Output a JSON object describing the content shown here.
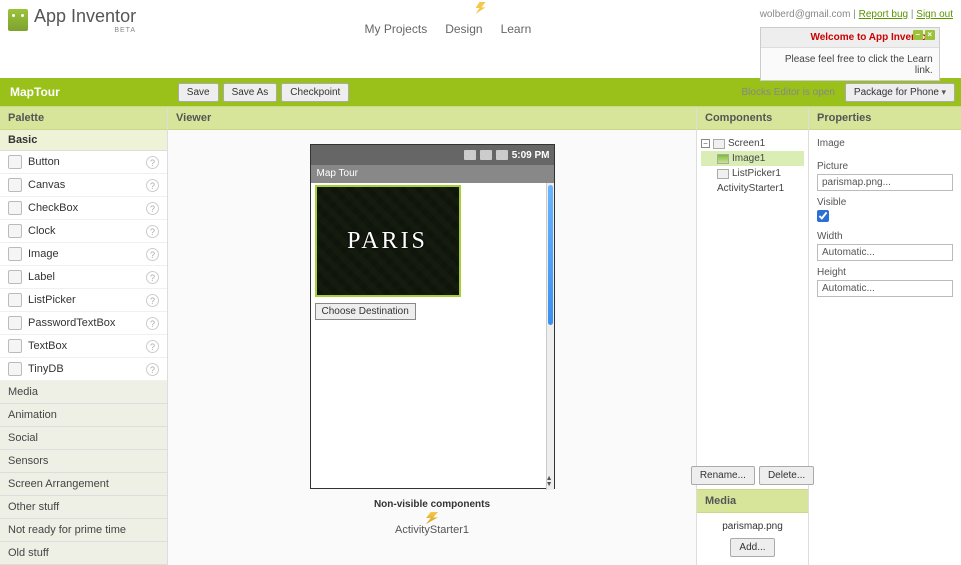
{
  "header": {
    "app_name": "App Inventor",
    "app_sub": "BETA",
    "nav": {
      "projects": "My Projects",
      "design": "Design",
      "learn": "Learn"
    },
    "user_email": "wolberd@gmail.com",
    "report_bug": "Report bug",
    "sign_out": "Sign out",
    "welcome_title": "Welcome to App Inventor.",
    "welcome_body": "Please feel free to click the Learn link."
  },
  "greenbar": {
    "title": "MapTour",
    "save": "Save",
    "save_as": "Save As",
    "checkpoint": "Checkpoint",
    "editor_status": "Blocks Editor is open",
    "package": "Package for Phone"
  },
  "palette": {
    "header": "Palette",
    "basic": "Basic",
    "items": [
      {
        "label": "Button"
      },
      {
        "label": "Canvas"
      },
      {
        "label": "CheckBox"
      },
      {
        "label": "Clock"
      },
      {
        "label": "Image"
      },
      {
        "label": "Label"
      },
      {
        "label": "ListPicker"
      },
      {
        "label": "PasswordTextBox"
      },
      {
        "label": "TextBox"
      },
      {
        "label": "TinyDB"
      }
    ],
    "drawers": [
      "Media",
      "Animation",
      "Social",
      "Sensors",
      "Screen Arrangement",
      "Other stuff",
      "Not ready for prime time",
      "Old stuff"
    ]
  },
  "viewer": {
    "header": "Viewer",
    "status_time": "5:09 PM",
    "app_title": "Map Tour",
    "paris_text": "PARIS",
    "choose_dest": "Choose Destination",
    "nonvis_header": "Non-visible components",
    "nonvis_item": "ActivityStarter1"
  },
  "components": {
    "header": "Components",
    "screen": "Screen1",
    "image": "Image1",
    "listpicker": "ListPicker1",
    "activity": "ActivityStarter1",
    "rename": "Rename...",
    "delete": "Delete...",
    "media_header": "Media",
    "media_file": "parismap.png",
    "add": "Add..."
  },
  "properties": {
    "header": "Properties",
    "component_type": "Image",
    "picture_label": "Picture",
    "picture_value": "parismap.png...",
    "visible_label": "Visible",
    "visible_checked": true,
    "width_label": "Width",
    "width_value": "Automatic...",
    "height_label": "Height",
    "height_value": "Automatic..."
  }
}
